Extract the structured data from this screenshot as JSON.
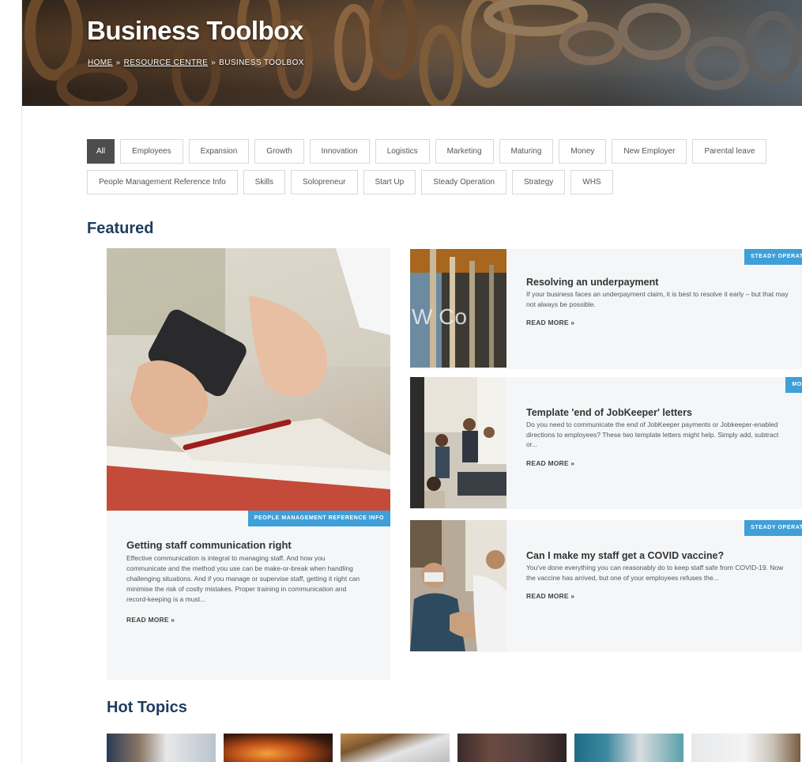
{
  "hero": {
    "title": "Business Toolbox",
    "breadcrumb": {
      "home": "HOME",
      "resource_centre": "RESOURCE CENTRE",
      "current": "BUSINESS TOOLBOX",
      "separator": "»"
    }
  },
  "filters": {
    "row1": [
      "All",
      "Employees",
      "Expansion",
      "Growth",
      "Innovation",
      "Logistics",
      "Marketing",
      "Maturing",
      "Money",
      "New Employer",
      "Parental leave"
    ],
    "row2": [
      "People Management Reference Info",
      "Skills",
      "Solopreneur",
      "Start Up",
      "Steady Operation",
      "Strategy",
      "WHS"
    ],
    "active": "All"
  },
  "featured": {
    "heading": "Featured",
    "big_card": {
      "category": "PEOPLE MANAGEMENT REFERENCE INFO",
      "title": "Getting staff communication right",
      "description": "Effective communication is integral to managing staff. And how you communicate and the method you use can be make-or-break when handling challenging situations. And if you manage or supervise staff, getting it right can minimise the risk of costly mistakes. Proper training in communication and record-keeping is a must...",
      "read_more": "READ MORE »"
    },
    "cards": [
      {
        "category": "STEADY OPERATION",
        "title": "Resolving an underpayment",
        "description": "If your business faces an underpayment claim, it is best to resolve it early – but that may not always be possible.",
        "read_more": "READ MORE »"
      },
      {
        "category": "MONEY",
        "title": "Template 'end of JobKeeper' letters",
        "description": "Do you need to communicate the end of JobKeeper payments or Jobkeeper-enabled directions to employees? These two template letters might help. Simply add, subtract or...",
        "read_more": "READ MORE »"
      },
      {
        "category": "STEADY OPERATION",
        "title": "Can I make my staff get a COVID vaccine?",
        "description": "You've done everything you can reasonably do to keep staff safe from COVID-19. Now the vaccine has arrived, but one of your employees refuses the...",
        "read_more": "READ MORE »"
      }
    ]
  },
  "hot_topics": {
    "heading": "Hot Topics"
  },
  "colors": {
    "heading": "#1f3b5e",
    "tag": "#3f9fd8",
    "chip_active": "#4d4d4d",
    "card_bg": "#f4f6f8"
  }
}
